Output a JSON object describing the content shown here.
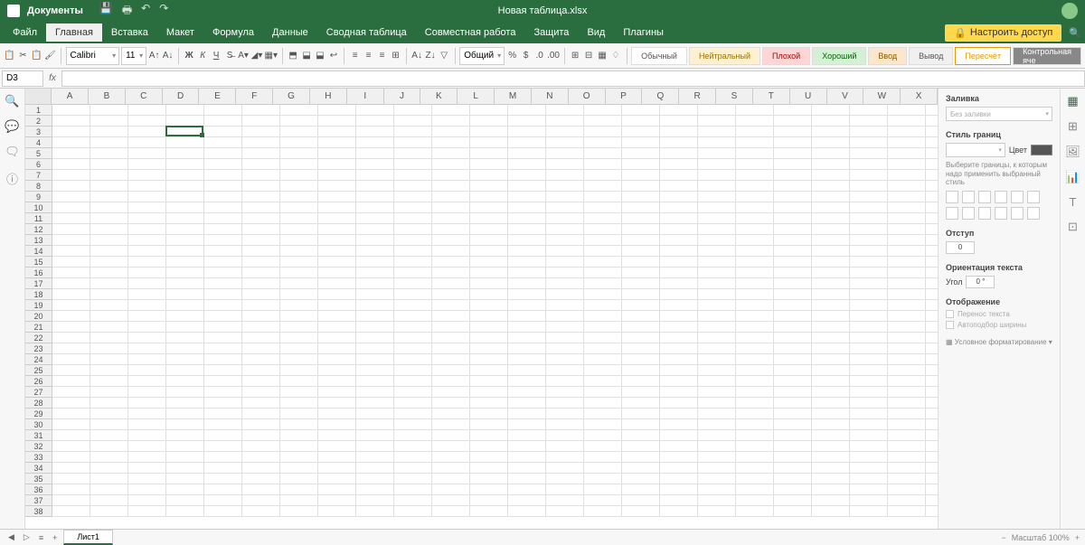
{
  "titlebar": {
    "app_name": "Документы",
    "doc_title": "Новая таблица.xlsx"
  },
  "menubar": {
    "items": [
      "Файл",
      "Главная",
      "Вставка",
      "Макет",
      "Формула",
      "Данные",
      "Сводная таблица",
      "Совместная работа",
      "Защита",
      "Вид",
      "Плагины"
    ],
    "active_index": 1,
    "share_label": "Настроить доступ"
  },
  "toolbar": {
    "font_name": "Calibri",
    "font_size": "11",
    "number_format": "Общий",
    "styles": {
      "normal": "Обычный",
      "neutral": "Нейтральный",
      "bad": "Плохой",
      "good": "Хороший",
      "input": "Ввод",
      "output": "Вывод",
      "calc": "Пересчёт",
      "check": "Контрольная яче"
    }
  },
  "fx": {
    "cell_ref": "D3",
    "fx_label": "fx"
  },
  "grid": {
    "columns": [
      "A",
      "B",
      "C",
      "D",
      "E",
      "F",
      "G",
      "H",
      "I",
      "J",
      "K",
      "L",
      "M",
      "N",
      "O",
      "P",
      "Q",
      "R",
      "S",
      "T",
      "U",
      "V",
      "W",
      "X"
    ],
    "rows": 38,
    "selected": {
      "col": 3,
      "row": 2
    }
  },
  "right_panel": {
    "fill_title": "Заливка",
    "fill_value": "Без заливки",
    "border_title": "Стиль границ",
    "color_label": "Цвет",
    "border_hint": "Выберите границы, к которым надо применить выбранный стиль",
    "indent_title": "Отступ",
    "indent_value": "0",
    "orient_title": "Ориентация текста",
    "angle_label": "Угол",
    "angle_value": "0 °",
    "display_title": "Отображение",
    "wrap_label": "Перенос текста",
    "autofit_label": "Автоподбор ширины",
    "cond_format": "Условное форматирование"
  },
  "statusbar": {
    "sheet_name": "Лист1",
    "zoom_label": "Масштаб 100%"
  }
}
